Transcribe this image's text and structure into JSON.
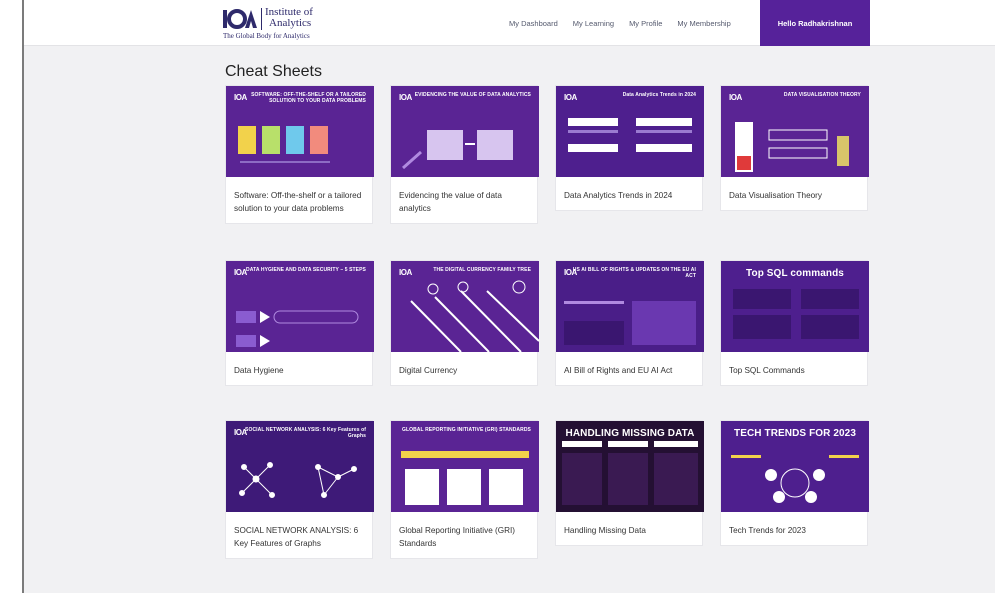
{
  "header": {
    "logo_mark": "IOA",
    "logo_line1": "Institute of",
    "logo_line2": "Analytics",
    "logo_tagline": "The Global Body for Analytics",
    "nav": [
      "My Dashboard",
      "My Learning",
      "My Profile",
      "My Membership"
    ],
    "user_greeting": "Hello Radhakrishnan",
    "accent_color": "#56229a"
  },
  "page": {
    "title": "Cheat Sheets"
  },
  "cards": [
    {
      "caption": "Software: Off-the-shelf or a tailored solution to your data problems",
      "thumb_title": "SOFTWARE: OFF-THE-SHELF OR A TAILORED SOLUTION TO YOUR DATA PROBLEMS"
    },
    {
      "caption": "Evidencing the value of data analytics",
      "thumb_title": "EVIDENCING THE VALUE OF DATA ANALYTICS"
    },
    {
      "caption": "Data Analytics Trends in 2024",
      "thumb_title": "Data Analytics Trends in 2024"
    },
    {
      "caption": "Data Visualisation Theory",
      "thumb_title": "DATA VISUALISATION THEORY"
    },
    {
      "caption": "Data Hygiene",
      "thumb_title": "DATA HYGIENE AND DATA SECURITY – 5 STEPS"
    },
    {
      "caption": "Digital Currency",
      "thumb_title": "THE DIGITAL CURRENCY FAMILY TREE"
    },
    {
      "caption": "AI Bill of Rights and EU AI Act",
      "thumb_title": "US AI BILL OF RIGHTS & UPDATES ON THE EU AI ACT"
    },
    {
      "caption": "Top SQL Commands",
      "thumb_title": "Top SQL commands"
    },
    {
      "caption": "SOCIAL NETWORK ANALYSIS: 6 Key Features of Graphs",
      "thumb_title": "SOCIAL NETWORK ANALYSIS: 6 Key Features of Graphs"
    },
    {
      "caption": "Global Reporting Initiative (GRI) Standards",
      "thumb_title": "GLOBAL REPORTING INITIATIVE (GRI) STANDARDS"
    },
    {
      "caption": "Handling Missing Data",
      "thumb_title": "HANDLING MISSING DATA"
    },
    {
      "caption": "Tech Trends for 2023",
      "thumb_title": "TECH TRENDS FOR 2023"
    }
  ]
}
